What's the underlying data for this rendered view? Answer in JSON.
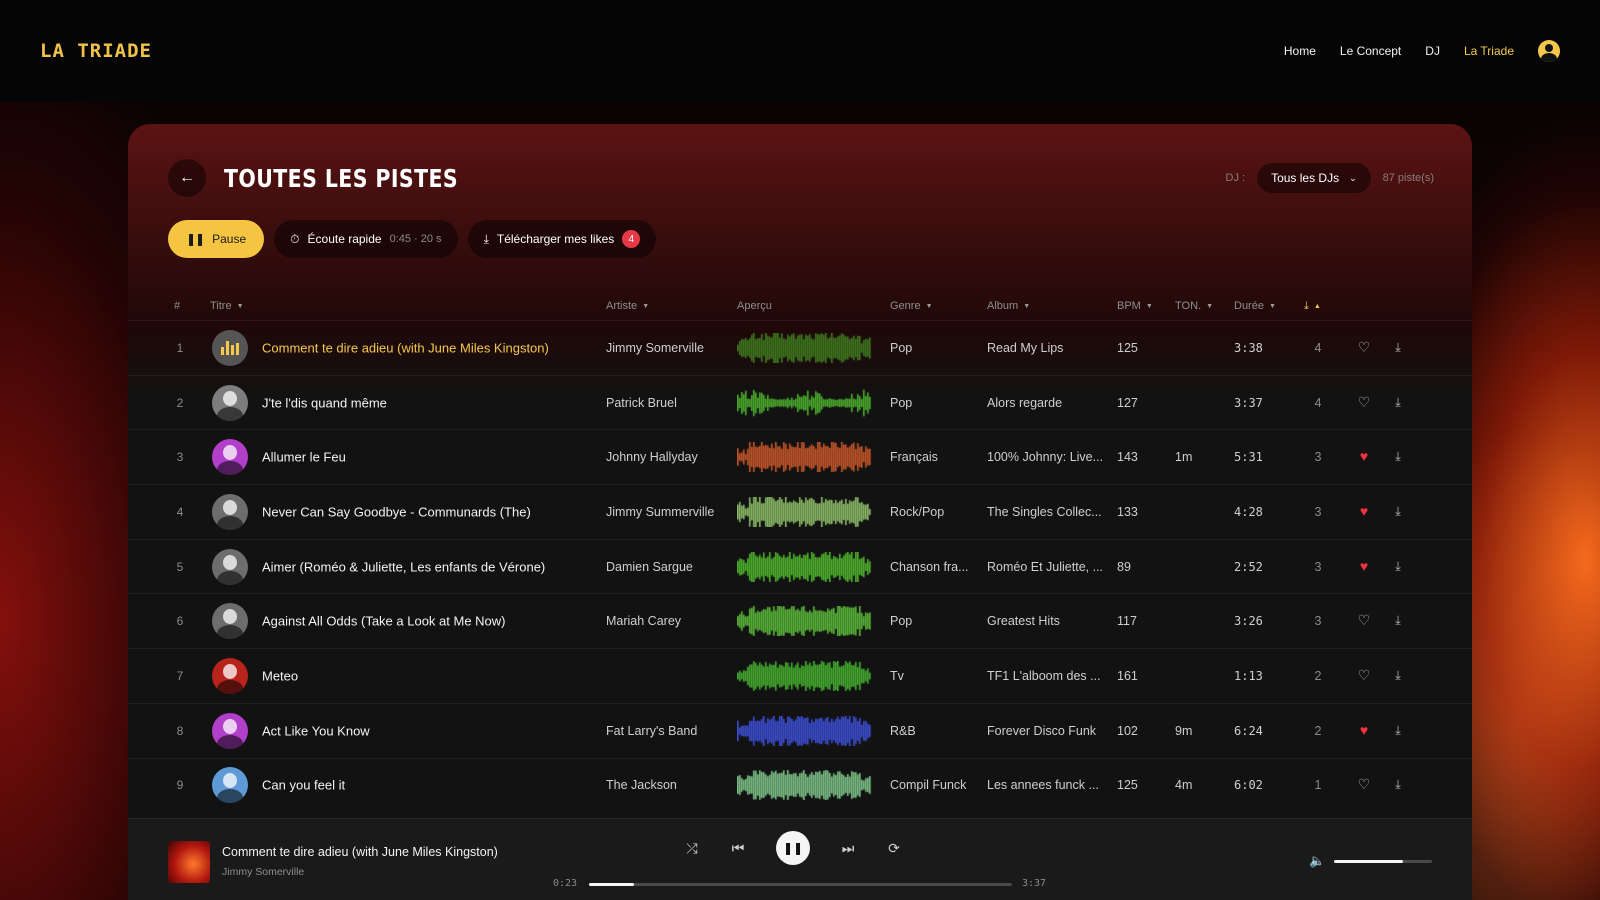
{
  "brand": {
    "logo": "LA TRIADE",
    "accent": "#f5c441"
  },
  "nav": {
    "links": [
      {
        "label": "Home",
        "active": false
      },
      {
        "label": "Le Concept",
        "active": false
      },
      {
        "label": "DJ",
        "active": false
      },
      {
        "label": "La Triade",
        "active": true
      }
    ]
  },
  "header": {
    "title": "TOUTES LES PISTES",
    "dj_label": "DJ :",
    "dj_selected": "Tous les DJs",
    "track_count": "87 piste(s)"
  },
  "actions": {
    "pause_label": "Pause",
    "quick_listen_label": "Écoute rapide",
    "quick_listen_sub": "0:45 · 20 s",
    "download_likes_label": "Télécharger mes likes",
    "download_likes_count": "4"
  },
  "table": {
    "columns": {
      "num": "#",
      "title": "Titre",
      "artist": "Artiste",
      "preview": "Aperçu",
      "genre": "Genre",
      "album": "Album",
      "bpm": "BPM",
      "key": "TON.",
      "duration": "Durée"
    },
    "rows": [
      {
        "num": "1",
        "title": "Comment te dire adieu (with June Miles Kingston)",
        "artist": "Jimmy Somerville",
        "genre": "Pop",
        "album": "Read My Lips",
        "bpm": "125",
        "key": "",
        "duration": "3:38",
        "downloads": "4",
        "liked": false,
        "playing": true,
        "wave_color": "#3f7a1f",
        "thumb_color": "#555"
      },
      {
        "num": "2",
        "title": "J'te l'dis quand même",
        "artist": "Patrick Bruel",
        "genre": "Pop",
        "album": "Alors regarde",
        "bpm": "127",
        "key": "",
        "duration": "3:37",
        "downloads": "4",
        "liked": false,
        "playing": false,
        "wave_color": "#4caf2e",
        "thumb_color": "#7d7d7d"
      },
      {
        "num": "3",
        "title": "Allumer le Feu",
        "artist": "Johnny Hallyday",
        "genre": "Français",
        "album": "100% Johnny: Live...",
        "bpm": "143",
        "key": "1m",
        "duration": "5:31",
        "downloads": "3",
        "liked": true,
        "playing": false,
        "wave_color": "#c9582a",
        "thumb_color": "#b23fc9"
      },
      {
        "num": "4",
        "title": "Never Can Say Goodbye - Communards (The)",
        "artist": "Jimmy Summerville",
        "genre": "Rock/Pop",
        "album": "The Singles Collec...",
        "bpm": "133",
        "key": "",
        "duration": "4:28",
        "downloads": "3",
        "liked": true,
        "playing": false,
        "wave_color": "#8fbf6a",
        "thumb_color": "#6d6d6d"
      },
      {
        "num": "5",
        "title": "Aimer (Roméo & Juliette, Les enfants de Vérone)",
        "artist": "Damien Sargue",
        "genre": "Chanson fra...",
        "album": "Roméo Et Juliette, ...",
        "bpm": "89",
        "key": "",
        "duration": "2:52",
        "downloads": "3",
        "liked": true,
        "playing": false,
        "wave_color": "#4fb52e",
        "thumb_color": "#6d6d6d"
      },
      {
        "num": "6",
        "title": "Against All Odds (Take a Look at Me Now)",
        "artist": "Mariah Carey",
        "genre": "Pop",
        "album": "Greatest Hits",
        "bpm": "117",
        "key": "",
        "duration": "3:26",
        "downloads": "3",
        "liked": false,
        "playing": false,
        "wave_color": "#5cba3a",
        "thumb_color": "#6d6d6d"
      },
      {
        "num": "7",
        "title": "Meteo",
        "artist": "",
        "genre": "Tv",
        "album": "TF1 L'alboom des ...",
        "bpm": "161",
        "key": "",
        "duration": "1:13",
        "downloads": "2",
        "liked": false,
        "playing": false,
        "wave_color": "#46b030",
        "thumb_color": "#b8241c"
      },
      {
        "num": "8",
        "title": "Act Like You Know",
        "artist": "Fat Larry's Band",
        "genre": "R&B",
        "album": "Forever Disco Funk",
        "bpm": "102",
        "key": "9m",
        "duration": "6:24",
        "downloads": "2",
        "liked": true,
        "playing": false,
        "wave_color": "#3e4fd6",
        "thumb_color": "#b23fc9"
      },
      {
        "num": "9",
        "title": "Can you feel it",
        "artist": "The Jackson",
        "genre": "Compil Funck",
        "album": "Les annees funck ...",
        "bpm": "125",
        "key": "4m",
        "duration": "6:02",
        "downloads": "1",
        "liked": false,
        "playing": false,
        "wave_color": "#7fc58a",
        "thumb_color": "#5e9ad6"
      }
    ]
  },
  "player": {
    "title": "Comment te dire adieu (with June Miles Kingston)",
    "artist": "Jimmy Somerville",
    "elapsed": "0:23",
    "total": "3:37",
    "progress": 0.106,
    "volume": 0.7
  }
}
